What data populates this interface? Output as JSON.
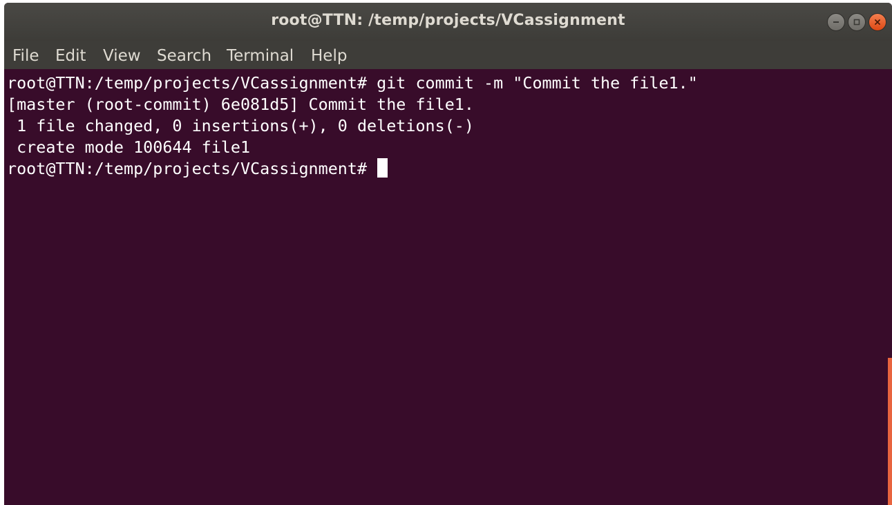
{
  "window": {
    "title": "root@TTN: /temp/projects/VCassignment",
    "controls": [
      "minimize-icon",
      "maximize-icon",
      "close-icon"
    ]
  },
  "menu": [
    "File",
    "Edit",
    "View",
    "Search",
    "Terminal",
    "Help"
  ],
  "terminal": {
    "lines": [
      "root@TTN:/temp/projects/VCassignment# git commit -m \"Commit the file1.\"",
      "[master (root-commit) 6e081d5] Commit the file1.",
      " 1 file changed, 0 insertions(+), 0 deletions(-)",
      " create mode 100644 file1"
    ],
    "prompt": "root@TTN:/temp/projects/VCassignment# "
  },
  "colors": {
    "terminal_background": "#380c2a",
    "titlebar": "#3d3c38",
    "close_button": "#e95420",
    "scrollbar": "#e8643f"
  }
}
